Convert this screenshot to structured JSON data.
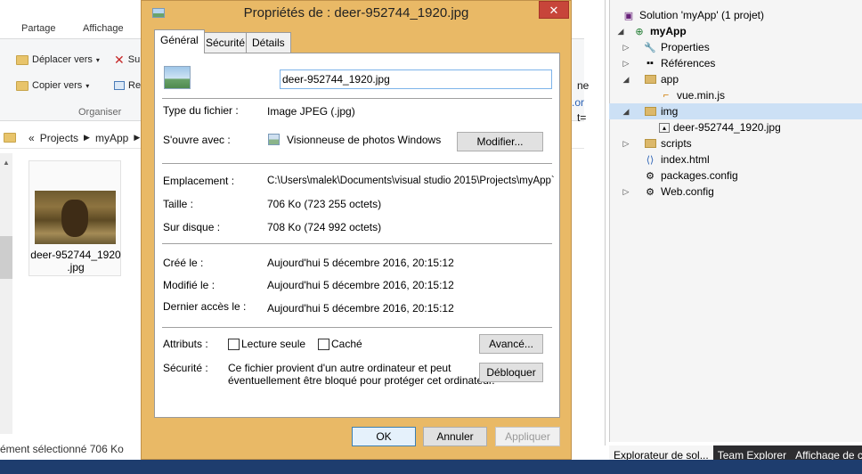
{
  "explorer": {
    "tabs": [
      "Partage",
      "Affichage"
    ],
    "ribbon": {
      "move_to": "Déplacer vers",
      "copy_to": "Copier vers",
      "delete_partial": "Su",
      "rename_partial": "Re",
      "group_label": "Organiser"
    },
    "address": {
      "sep": "«",
      "crumbs": [
        "Projects",
        "myApp"
      ]
    },
    "file": {
      "name_line1": "deer-952744_1920",
      "name_line2": ".jpg"
    },
    "status": "ément sélectionné  706 Ko"
  },
  "dialog": {
    "title": "Propriétés de : deer-952744_1920.jpg",
    "close": "✕",
    "tabs": [
      "Général",
      "Sécurité",
      "Détails"
    ],
    "filename": "deer-952744_1920.jpg",
    "file_type_label": "Type du fichier :",
    "file_type_value": "Image JPEG (.jpg)",
    "opens_with_label": "S'ouvre avec :",
    "opens_with_value": "Visionneuse de photos Windows",
    "change_button": "Modifier...",
    "location_label": "Emplacement :",
    "location_value": "C:\\Users\\malek\\Documents\\visual studio 2015\\Projects\\myApp`",
    "size_label": "Taille :",
    "size_value": "706 Ko (723 255 octets)",
    "disk_label": "Sur disque :",
    "disk_value": "708 Ko (724 992 octets)",
    "created_label": "Créé le :",
    "created_value": "Aujourd'hui 5 décembre 2016, 20:15:12",
    "modified_label": "Modifié le :",
    "modified_value": "Aujourd'hui 5 décembre 2016, 20:15:12",
    "accessed_label": "Dernier accès le :",
    "accessed_value": "Aujourd'hui 5 décembre 2016, 20:15:12",
    "attributes_label": "Attributs :",
    "readonly_label": "Lecture seule",
    "hidden_label": "Caché",
    "advanced_button": "Avancé...",
    "security_label": "Sécurité :",
    "security_text_1": "Ce fichier provient d'un autre ordinateur et peut",
    "security_text_2": "éventuellement être bloqué pour protéger cet ordinateur.",
    "unblock_button": "Débloquer",
    "ok": "OK",
    "cancel": "Annuler",
    "apply": "Appliquer"
  },
  "vs": {
    "side_text_1": "ne",
    "side_text_2": ".or",
    "side_text_3": "t=",
    "tree": [
      {
        "label": "Solution 'myApp' (1 projet)",
        "icon": "solution-icon"
      },
      {
        "label": "myApp",
        "icon": "project-icon"
      },
      {
        "label": "Properties",
        "icon": "wrench-icon"
      },
      {
        "label": "Références",
        "icon": "references-icon"
      },
      {
        "label": "app",
        "icon": "folder-icon"
      },
      {
        "label": "vue.min.js",
        "icon": "js-file-icon"
      },
      {
        "label": "img",
        "icon": "folder-open-icon"
      },
      {
        "label": "deer-952744_1920.jpg",
        "icon": "image-file-icon"
      },
      {
        "label": "scripts",
        "icon": "folder-icon"
      },
      {
        "label": "index.html",
        "icon": "html-file-icon"
      },
      {
        "label": "packages.config",
        "icon": "config-file-icon"
      },
      {
        "label": "Web.config",
        "icon": "config-file-icon"
      }
    ],
    "tabs": [
      "Explorateur de sol...",
      "Team Explorer",
      "Affichage de c"
    ]
  }
}
